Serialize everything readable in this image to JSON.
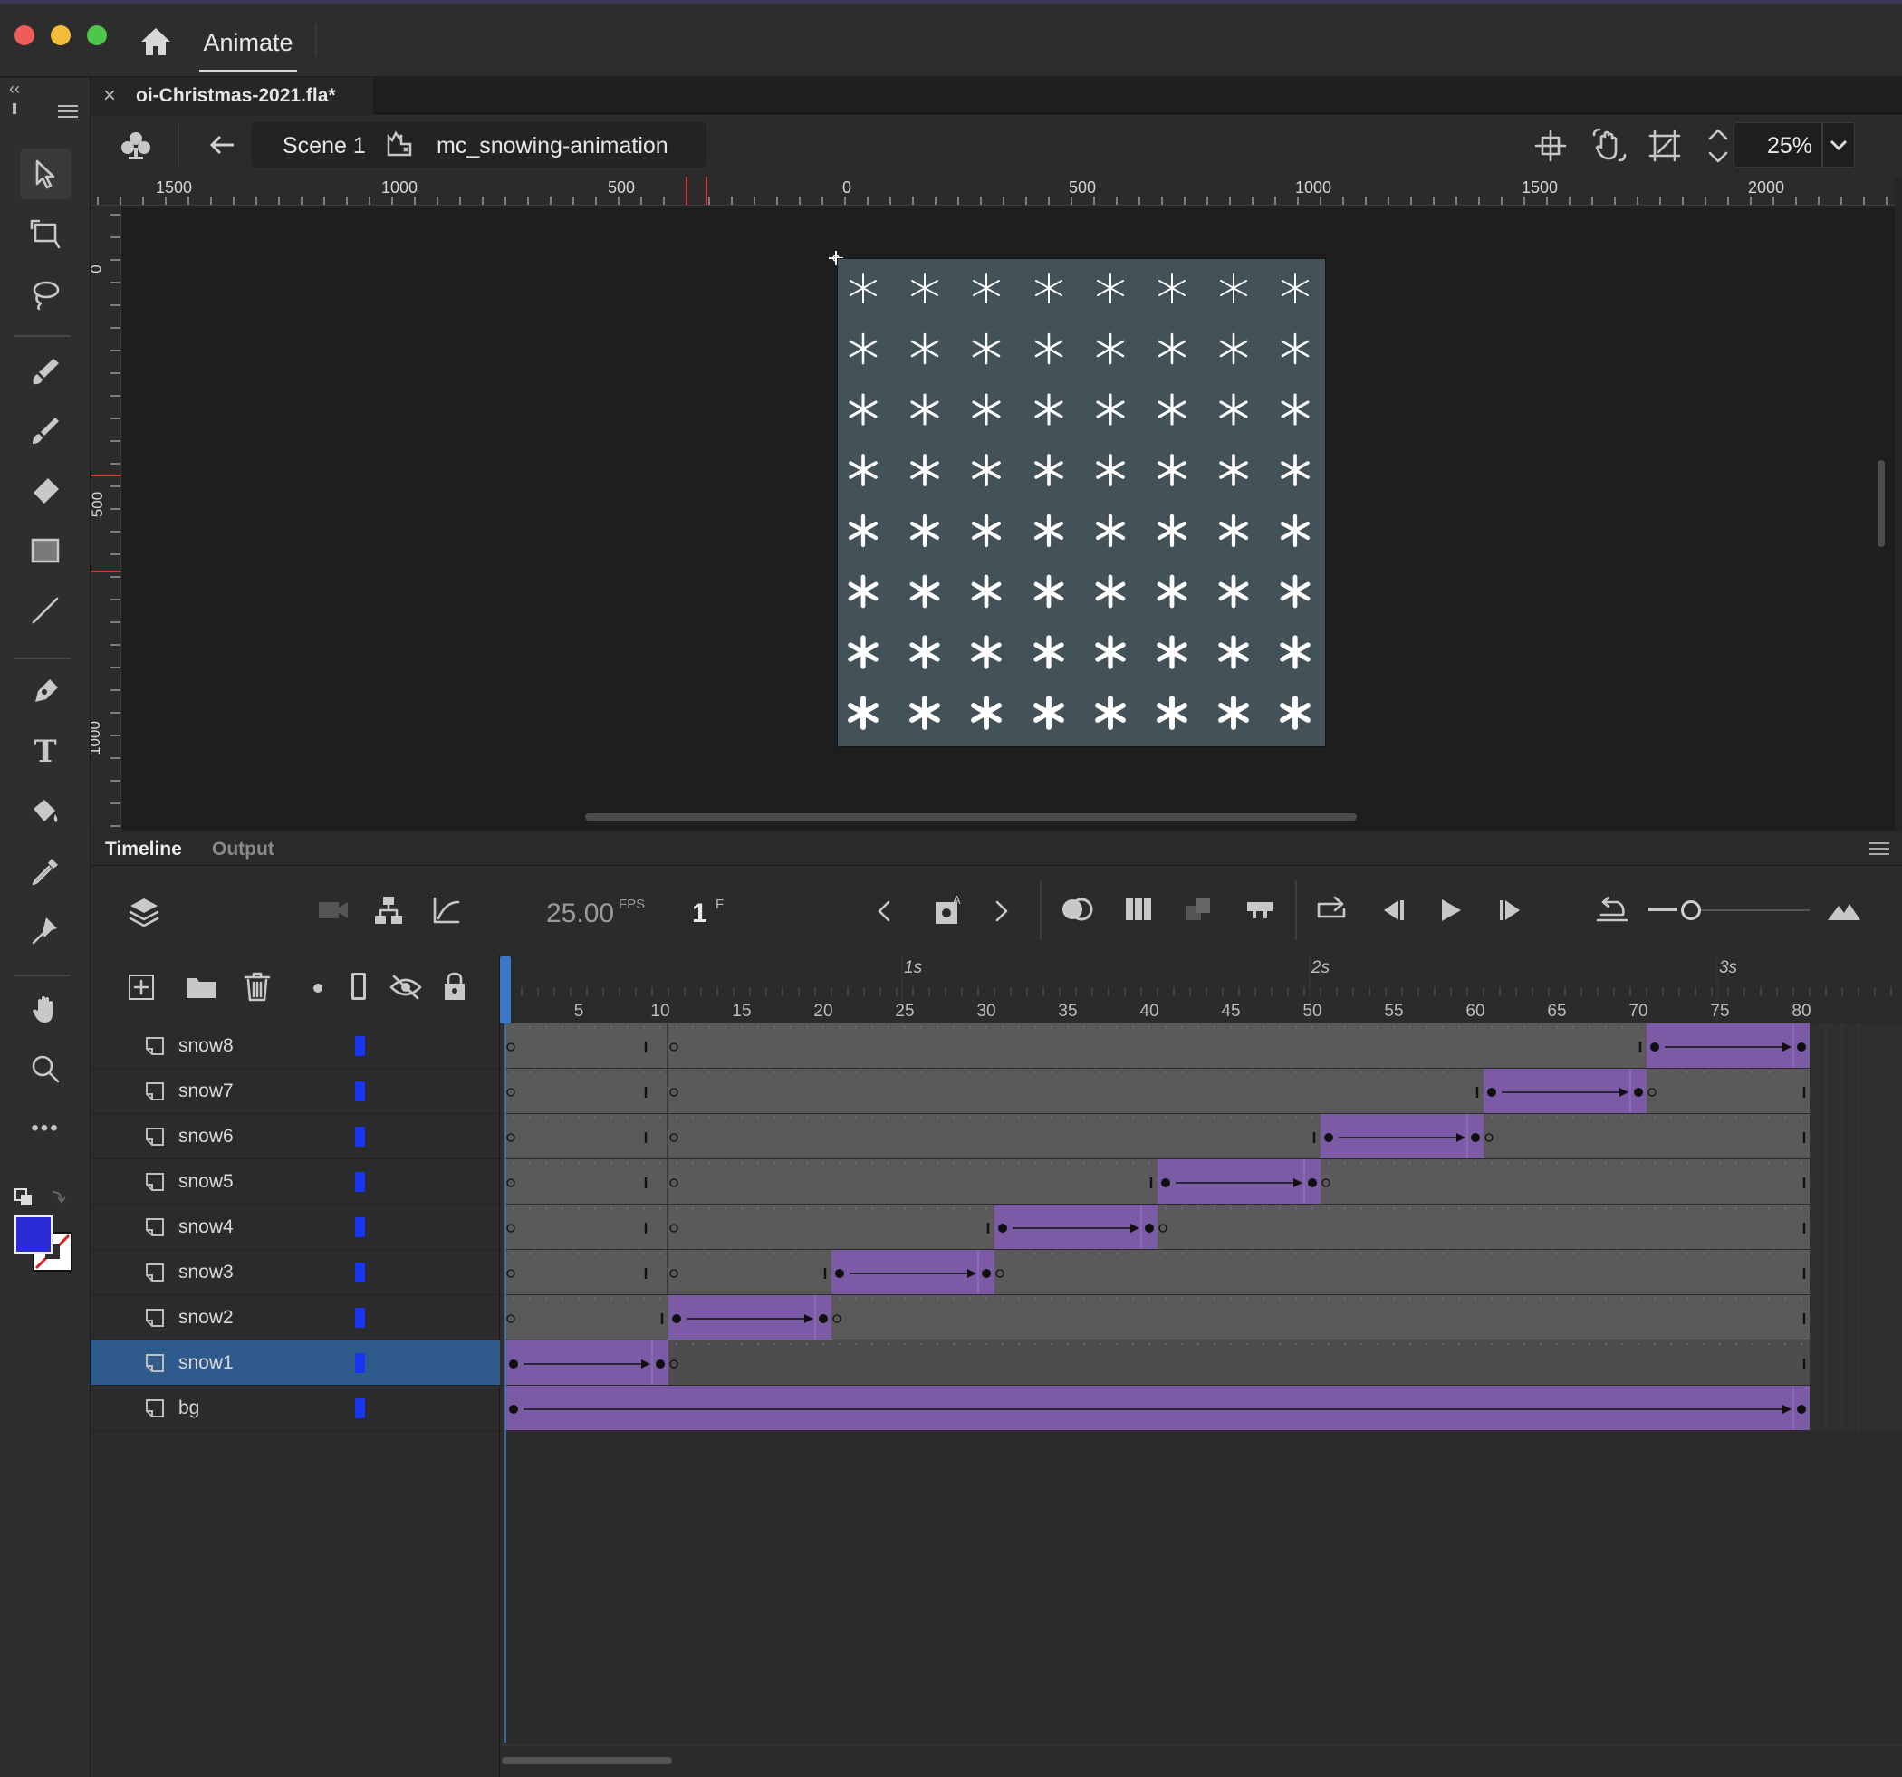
{
  "window": {
    "app_tab": "Animate",
    "document_tab": "oi-Christmas-2021.fla*",
    "close_glyph": "×"
  },
  "breadcrumbs": {
    "scene": "Scene 1",
    "symbol": "mc_snowing-animation"
  },
  "zoom": {
    "value": "25%"
  },
  "rulers": {
    "horizontal": [
      "1500",
      "1000",
      "500",
      "0",
      "500",
      "1000",
      "1500",
      "2000"
    ],
    "vertical": [
      "0",
      "500",
      "1000"
    ]
  },
  "toolbar": {
    "collapse_glyph": "‹‹",
    "tools": [
      "selection-tool-icon",
      "free-transform-icon",
      "lasso-icon",
      "fluid-brush-icon",
      "paint-brush-icon",
      "eraser-icon",
      "rectangle-icon",
      "line-icon",
      "pen-icon",
      "text-icon",
      "paint-bucket-icon",
      "eyedropper-icon",
      "bone-pin-icon",
      "hand-icon",
      "zoom-icon",
      "more-icon"
    ],
    "more_glyph": "•••",
    "text_tool_glyph": "T",
    "fill_color": "#2a2ad6",
    "stroke_color": "#ffffff"
  },
  "stage": {
    "background": "#435259",
    "flake_rows": 8,
    "flake_cols": 8
  },
  "timeline": {
    "tabs": [
      "Timeline",
      "Output"
    ],
    "fps": "25.00",
    "fps_unit": "FPS",
    "current_frame": "1",
    "frame_unit": "F",
    "frame_numbers": [
      "5",
      "10",
      "15",
      "20",
      "25",
      "30",
      "35",
      "40",
      "45",
      "50",
      "55",
      "60",
      "65",
      "70",
      "75",
      "80"
    ],
    "seconds": [
      "1s",
      "2s",
      "3s"
    ],
    "total_frames": 80,
    "tween_color": "#7b5aa6",
    "layers": [
      {
        "name": "snow8",
        "tween_start": 71,
        "tween_end": 80
      },
      {
        "name": "snow7",
        "tween_start": 61,
        "tween_end": 70
      },
      {
        "name": "snow6",
        "tween_start": 51,
        "tween_end": 60
      },
      {
        "name": "snow5",
        "tween_start": 41,
        "tween_end": 50
      },
      {
        "name": "snow4",
        "tween_start": 31,
        "tween_end": 40
      },
      {
        "name": "snow3",
        "tween_start": 21,
        "tween_end": 30
      },
      {
        "name": "snow2",
        "tween_start": 11,
        "tween_end": 20
      },
      {
        "name": "snow1",
        "tween_start": 1,
        "tween_end": 10,
        "selected": true
      },
      {
        "name": "bg",
        "tween_start": 1,
        "tween_end": 80
      }
    ],
    "layer_color": "#1735f5"
  }
}
